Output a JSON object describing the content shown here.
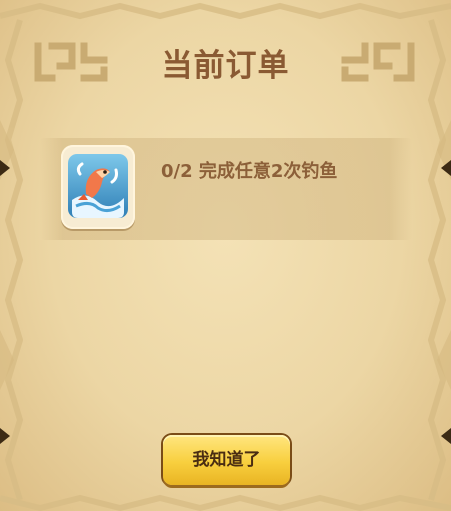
{
  "panel": {
    "title": "当前订单"
  },
  "order": {
    "progress_text": "0/2 完成任意2次钓鱼",
    "icon": "fish-jumping-icon"
  },
  "buttons": {
    "ok_label": "我知道了"
  },
  "colors": {
    "parchment": "#ecd6a4",
    "title_brown": "#8a5a33",
    "button_yellow": "#f8cf3e",
    "button_text": "#4a2d12"
  }
}
